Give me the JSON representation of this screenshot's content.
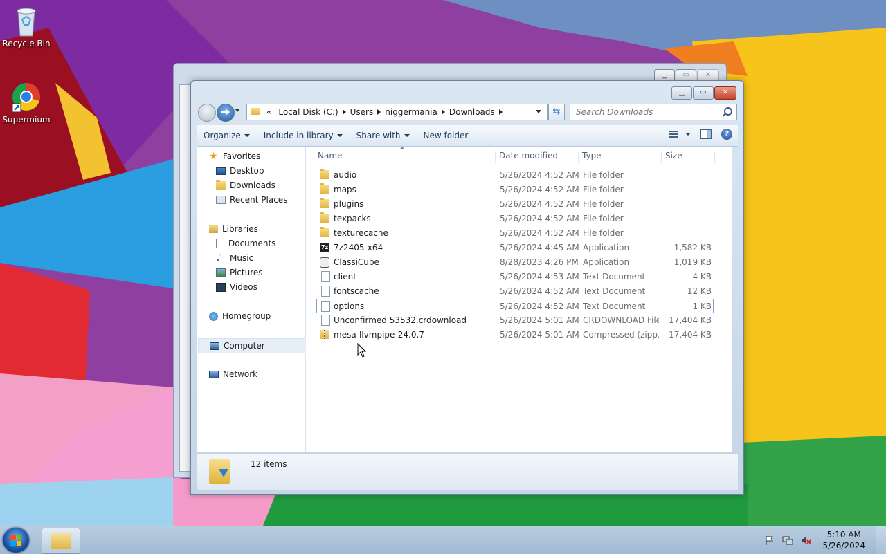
{
  "desktop": {
    "icons": [
      {
        "label": "Recycle Bin"
      },
      {
        "label": "Supermium"
      }
    ]
  },
  "window": {
    "address": {
      "chevron": "«",
      "segments": [
        "Local Disk (C:)",
        "Users",
        "niggermania",
        "Downloads"
      ]
    },
    "search": {
      "placeholder": "Search Downloads"
    },
    "toolbar": {
      "organize": "Organize",
      "include_in_library": "Include in library",
      "share_with": "Share with",
      "new_folder": "New folder"
    },
    "nav": {
      "favorites": "Favorites",
      "desktop": "Desktop",
      "downloads": "Downloads",
      "recent_places": "Recent Places",
      "libraries": "Libraries",
      "documents": "Documents",
      "music": "Music",
      "pictures": "Pictures",
      "videos": "Videos",
      "homegroup": "Homegroup",
      "computer": "Computer",
      "network": "Network"
    },
    "columns": {
      "name": "Name",
      "date": "Date modified",
      "type": "Type",
      "size": "Size"
    },
    "files": [
      {
        "name": "audio",
        "date": "5/26/2024 4:52 AM",
        "type": "File folder",
        "size": "",
        "icon": "folder-icon"
      },
      {
        "name": "maps",
        "date": "5/26/2024 4:52 AM",
        "type": "File folder",
        "size": "",
        "icon": "folder-icon"
      },
      {
        "name": "plugins",
        "date": "5/26/2024 4:52 AM",
        "type": "File folder",
        "size": "",
        "icon": "folder-icon"
      },
      {
        "name": "texpacks",
        "date": "5/26/2024 4:52 AM",
        "type": "File folder",
        "size": "",
        "icon": "folder-icon"
      },
      {
        "name": "texturecache",
        "date": "5/26/2024 4:52 AM",
        "type": "File folder",
        "size": "",
        "icon": "folder-icon"
      },
      {
        "name": "7z2405-x64",
        "date": "5/26/2024 4:45 AM",
        "type": "Application",
        "size": "1,582 KB",
        "icon": "7zip-icon"
      },
      {
        "name": "ClassiCube",
        "date": "8/28/2023 4:26 PM",
        "type": "Application",
        "size": "1,019 KB",
        "icon": "classicube-icon"
      },
      {
        "name": "client",
        "date": "5/26/2024 4:53 AM",
        "type": "Text Document",
        "size": "4 KB",
        "icon": "text-document-icon"
      },
      {
        "name": "fontscache",
        "date": "5/26/2024 4:52 AM",
        "type": "Text Document",
        "size": "12 KB",
        "icon": "text-document-icon"
      },
      {
        "name": "options",
        "date": "5/26/2024 4:52 AM",
        "type": "Text Document",
        "size": "1 KB",
        "icon": "text-document-icon"
      },
      {
        "name": "Unconfirmed 53532.crdownload",
        "date": "5/26/2024 5:01 AM",
        "type": "CRDOWNLOAD File",
        "size": "17,404 KB",
        "icon": "text-document-icon"
      },
      {
        "name": "mesa-llvmpipe-24.0.7",
        "date": "5/26/2024 5:01 AM",
        "type": "Compressed (zipp...",
        "size": "17,404 KB",
        "icon": "zip-folder-icon"
      }
    ],
    "status": {
      "items_count": "12 items"
    }
  },
  "taskbar": {
    "clock_time": "5:10 AM",
    "clock_date": "5/26/2024"
  }
}
